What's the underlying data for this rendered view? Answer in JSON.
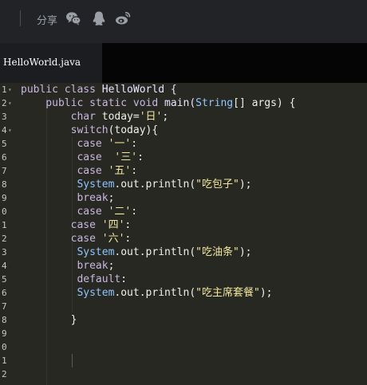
{
  "share": {
    "label": "分享",
    "icons": [
      "wechat-icon",
      "qq-icon",
      "weibo-icon"
    ]
  },
  "tab": {
    "title": "HelloWorld.java"
  },
  "gutter": {
    "numbers": [
      "1",
      "2",
      "3",
      "4",
      "5",
      "6",
      "7",
      "8",
      "9",
      "0",
      "1",
      "2",
      "3",
      "4",
      "5",
      "6",
      "7",
      "8",
      "9",
      "0",
      "1",
      "2"
    ],
    "fold_marks": [
      "▾",
      "▾",
      "",
      "▾",
      "",
      "",
      "",
      "",
      "",
      "",
      "",
      "",
      "",
      "",
      "",
      "",
      "",
      "",
      "",
      "",
      "",
      ""
    ]
  },
  "code": {
    "l1": {
      "a": "public class",
      "b": " HelloWorld {"
    },
    "l2": {
      "a": "    public static void",
      "b": " main(",
      "c": "String",
      "d": "[] args) {"
    },
    "l3": {
      "a": "        char",
      "b": " today=",
      "c": "'日'",
      "d": ";"
    },
    "l4": {
      "a": "        switch",
      "b": "(today){"
    },
    "l5": {
      "a": "         case",
      "b": " ",
      "c": "'一'",
      "d": ":"
    },
    "l6": {
      "a": "         case",
      "b": "  ",
      "c": "'三'",
      "d": ":"
    },
    "l7": {
      "a": "         case",
      "b": " ",
      "c": "'五'",
      "d": ":"
    },
    "l8": {
      "a": "         System",
      "b": ".out.println(",
      "c": "\"吃包子\"",
      "d": ");"
    },
    "l9": {
      "a": "         break",
      "b": ";"
    },
    "l10": {
      "a": "         case",
      "b": " ",
      "c": "'二'",
      "d": ":"
    },
    "l11": {
      "a": "        case",
      "b": " ",
      "c": "'四'",
      "d": ":"
    },
    "l12": {
      "a": "        case",
      "b": " ",
      "c": "'六'",
      "d": ":"
    },
    "l13": {
      "a": "         System",
      "b": ".out.println(",
      "c": "\"吃油条\"",
      "d": ");"
    },
    "l14": {
      "a": "         break",
      "b": ";"
    },
    "l15": {
      "a": "         default",
      "b": ":"
    },
    "l16": {
      "a": "         System",
      "b": ".out.println(",
      "c": "\"吃主席套餐\"",
      "d": ");"
    },
    "l18": {
      "a": "        }"
    }
  }
}
